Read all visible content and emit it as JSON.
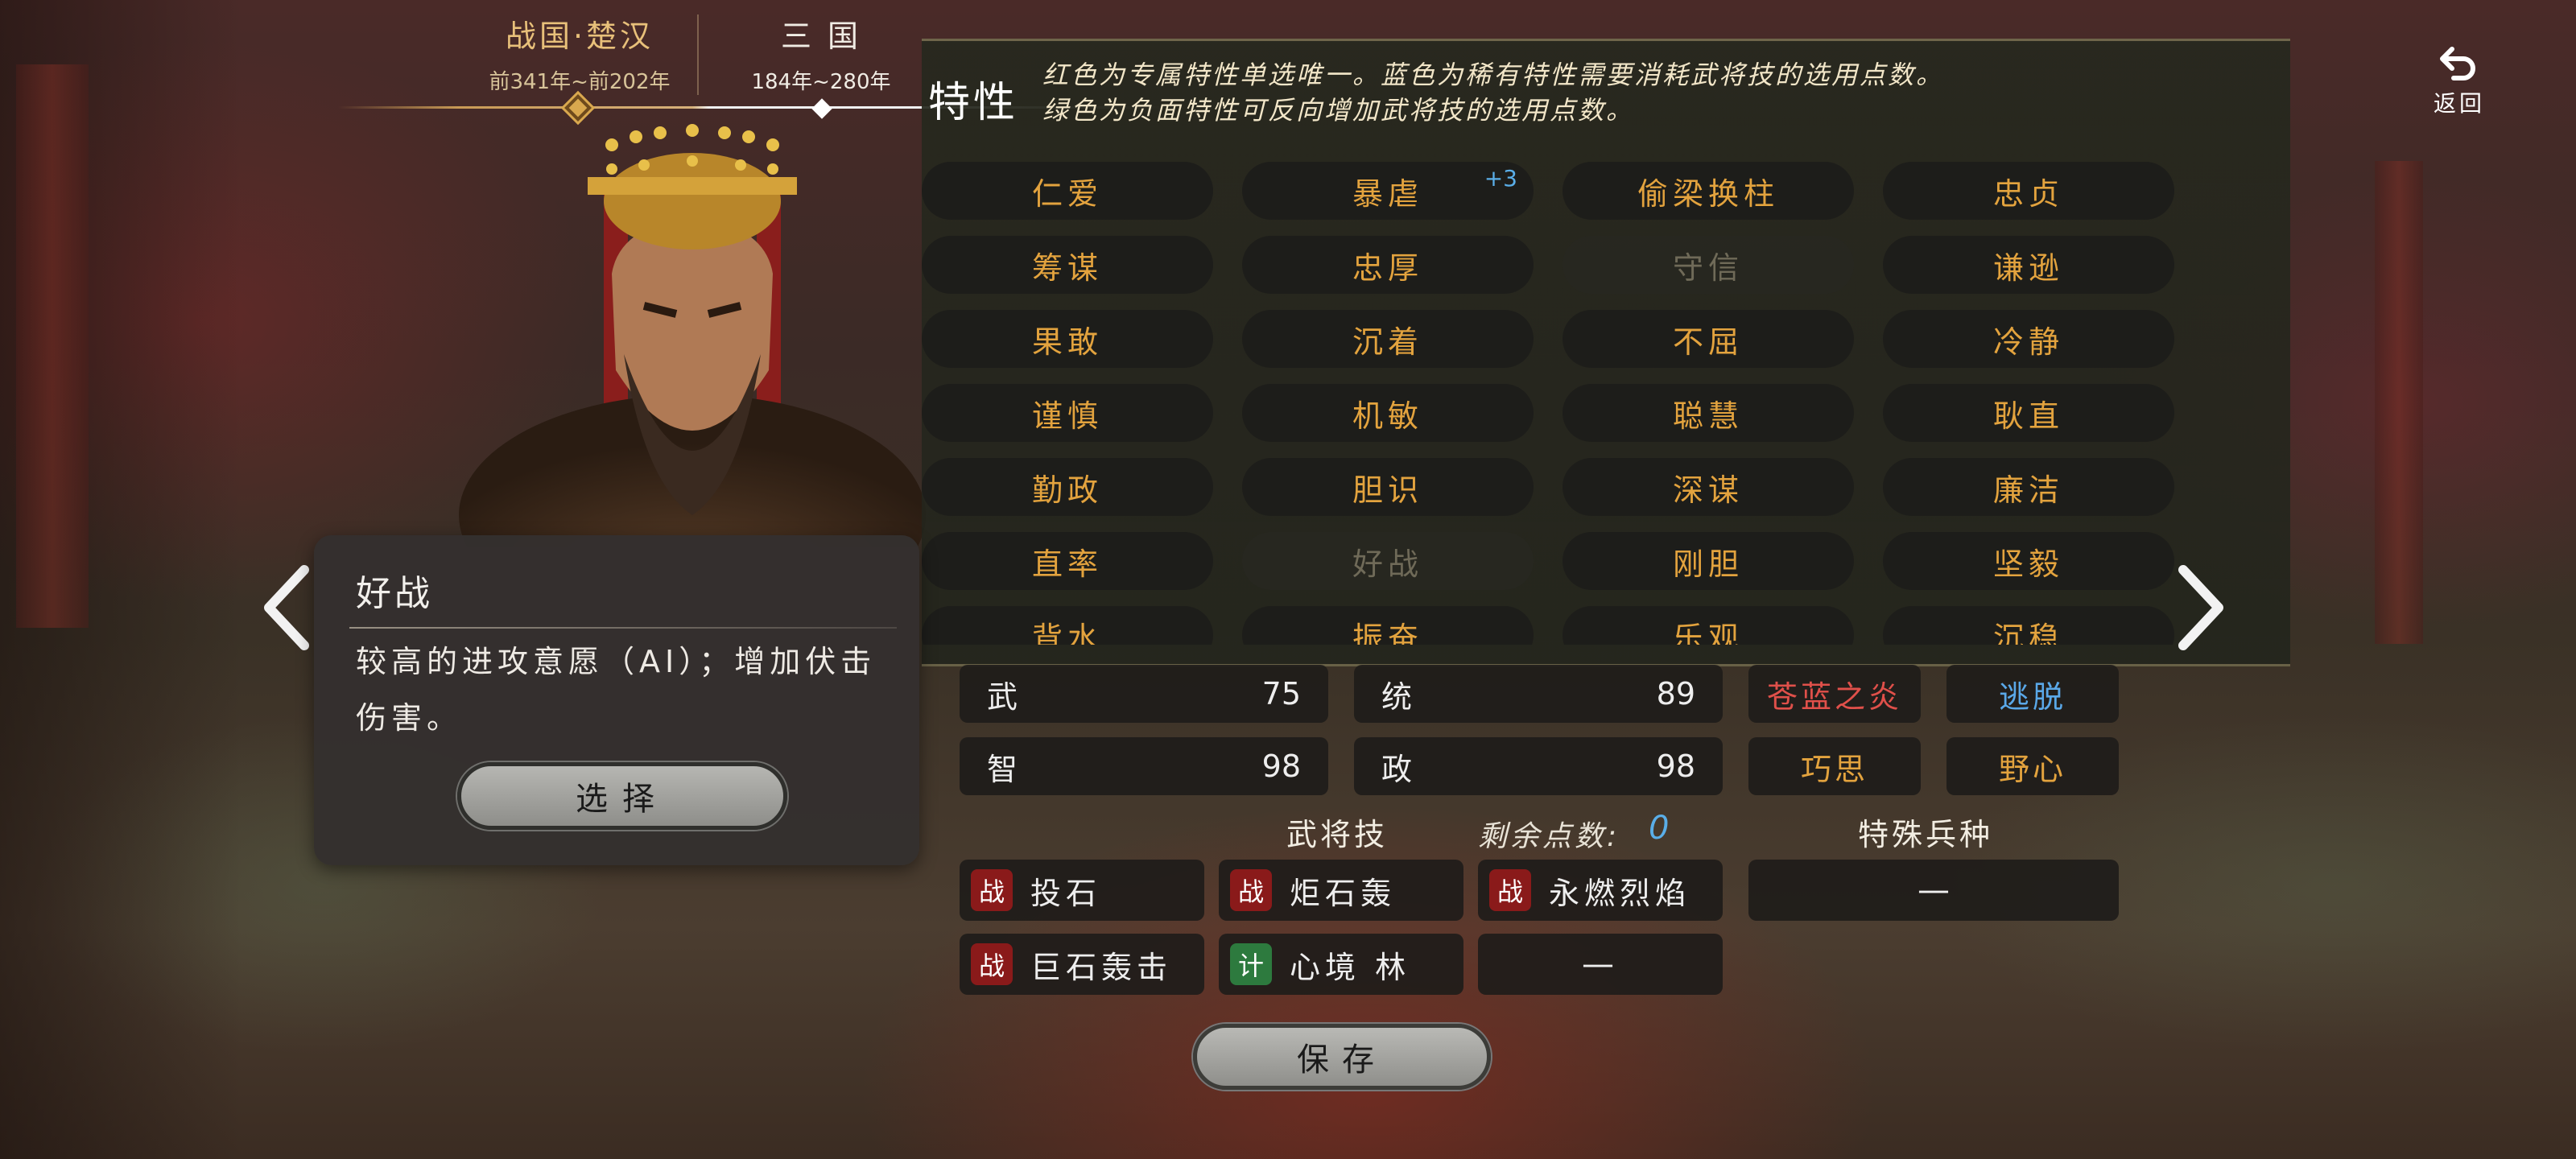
{
  "era_tabs": [
    {
      "name": "战国·楚汉",
      "years": "前341年~前202年"
    },
    {
      "name": "三 国",
      "years": "184年~280年"
    }
  ],
  "back": {
    "label": "返回"
  },
  "traits": {
    "title": "特性",
    "description": "红色为专属特性单选唯一。蓝色为稀有特性需要消耗武将技的选用点数。绿色为负面特性可反向增加武将技的选用点数。",
    "items": [
      {
        "label": "仁爱"
      },
      {
        "label": "暴虐",
        "cost": "+3"
      },
      {
        "label": "偷梁换柱"
      },
      {
        "label": "忠贞"
      },
      {
        "label": "筹谋"
      },
      {
        "label": "忠厚"
      },
      {
        "label": "守信"
      },
      {
        "label": "谦逊"
      },
      {
        "label": "果敢"
      },
      {
        "label": "沉着"
      },
      {
        "label": "不屈"
      },
      {
        "label": "冷静"
      },
      {
        "label": "谨慎"
      },
      {
        "label": "机敏"
      },
      {
        "label": "聪慧"
      },
      {
        "label": "耿直"
      },
      {
        "label": "勤政"
      },
      {
        "label": "胆识"
      },
      {
        "label": "深谋"
      },
      {
        "label": "廉洁"
      },
      {
        "label": "直率"
      },
      {
        "label": "好战"
      },
      {
        "label": "刚胆"
      },
      {
        "label": "坚毅"
      },
      {
        "label": "背水"
      },
      {
        "label": "振奋"
      },
      {
        "label": "乐观"
      },
      {
        "label": "沉稳"
      }
    ]
  },
  "stats": {
    "wu": {
      "label": "武",
      "value": "75"
    },
    "tong": {
      "label": "统",
      "value": "89"
    },
    "zhi": {
      "label": "智",
      "value": "98"
    },
    "zheng": {
      "label": "政",
      "value": "98"
    }
  },
  "trait_tags": [
    "苍蓝之炎",
    "逃脱",
    "巧思",
    "野心"
  ],
  "skills": {
    "header": "武将技",
    "remaining_label": "剩余点数:",
    "remaining_value": "0",
    "items": [
      {
        "type": "战",
        "name": "投石"
      },
      {
        "type": "战",
        "name": "炬石轰"
      },
      {
        "type": "战",
        "name": "永燃烈焰"
      },
      {
        "type": "战",
        "name": "巨石轰击"
      },
      {
        "type": "计",
        "name": "心境 林"
      }
    ],
    "empty_slot": "—"
  },
  "special_unit": {
    "header": "特殊兵种",
    "value": "—"
  },
  "save": {
    "label": "保存"
  },
  "tooltip": {
    "title": "好战",
    "body": "较高的进攻意愿（AI）；增加伏击伤害。",
    "button": "选择"
  }
}
